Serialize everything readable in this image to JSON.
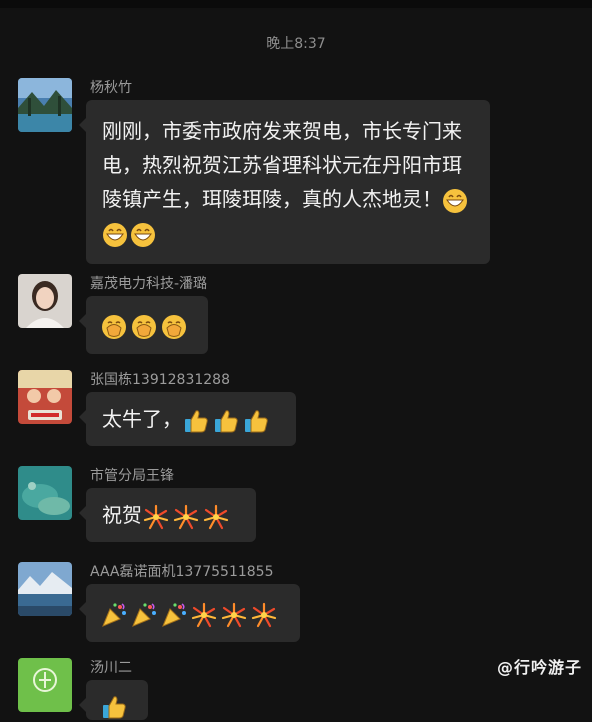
{
  "timestamp": "晚上8:37",
  "messages": [
    {
      "sender": "杨秋竹",
      "text": "刚刚，市委市政府发来贺电，市长专门来电，热烈祝贺江苏省理科状元在丹阳市珥陵镇产生，珥陵珥陵，真的人杰地灵！",
      "emojis": [
        "grin-icon",
        "grin-icon",
        "grin-icon"
      ]
    },
    {
      "sender": "嘉茂电力科技-潘璐",
      "text": "",
      "emojis": [
        "applause-icon",
        "applause-icon",
        "applause-icon"
      ]
    },
    {
      "sender": "张国栋13912831288",
      "text": "太牛了，",
      "emojis": [
        "thumbs-up-icon",
        "thumbs-up-icon",
        "thumbs-up-icon"
      ]
    },
    {
      "sender": "市管分局王锋",
      "text": "祝贺",
      "emojis": [
        "firework-icon",
        "firework-icon",
        "firework-icon"
      ]
    },
    {
      "sender": "AAA磊诺面机13775511855",
      "text": "",
      "emojis": [
        "party-popper-icon",
        "party-popper-icon",
        "party-popper-icon",
        "firework-icon",
        "firework-icon",
        "firework-icon"
      ]
    },
    {
      "sender": "汤川二",
      "text": "",
      "emojis": [
        "thumbs-up-icon"
      ]
    }
  ],
  "watermark": "@行吟游子",
  "colors": {
    "background": "#121212",
    "bubble": "#2b2b2b",
    "sender": "#9b9b9b",
    "timestamp": "#8e8e8e"
  }
}
